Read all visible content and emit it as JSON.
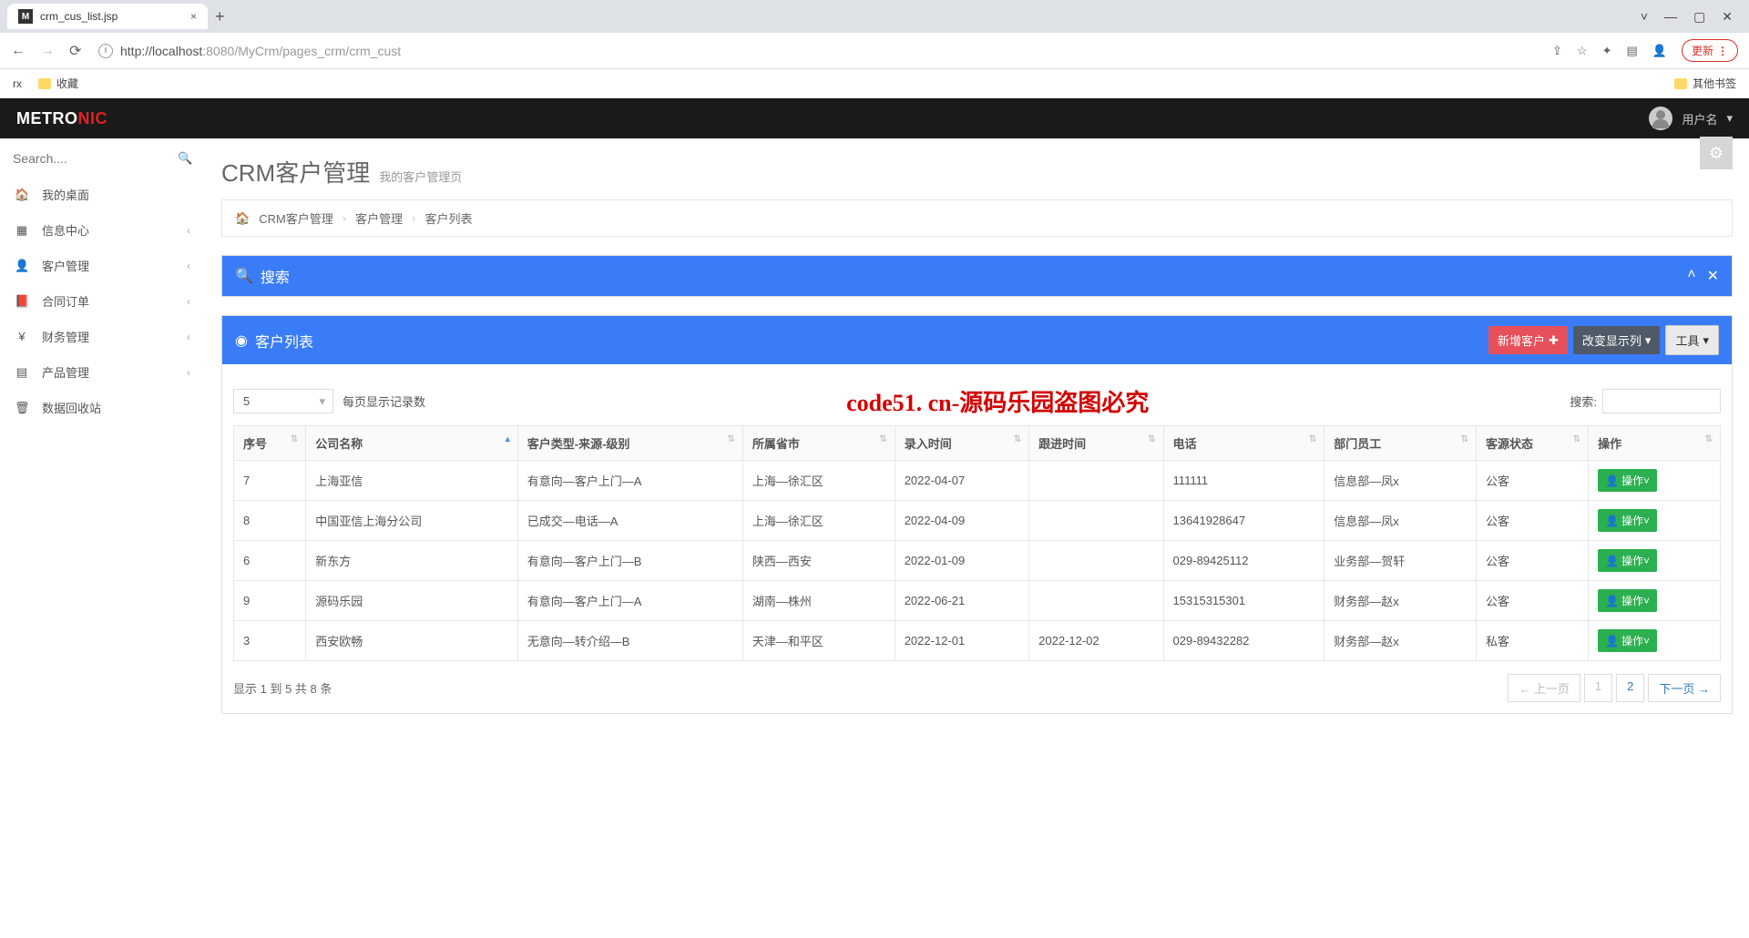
{
  "browser": {
    "tab_title": "crm_cus_list.jsp",
    "url_host": "http://localhost",
    "url_port": ":8080",
    "url_path": "/MyCrm/pages_crm/crm_cust",
    "update_btn": "更新",
    "bookmarks": [
      "rx",
      "收藏"
    ],
    "other_bookmarks": "其他书签"
  },
  "header": {
    "logo_main": "METRO",
    "logo_accent": "NIC",
    "username": "用户名"
  },
  "sidebar": {
    "search_placeholder": "Search....",
    "items": [
      {
        "label": "我的桌面",
        "expandable": false
      },
      {
        "label": "信息中心",
        "expandable": true
      },
      {
        "label": "客户管理",
        "expandable": true
      },
      {
        "label": "合同订单",
        "expandable": true
      },
      {
        "label": "财务管理",
        "expandable": true
      },
      {
        "label": "产品管理",
        "expandable": true
      },
      {
        "label": "数据回收站",
        "expandable": false
      }
    ]
  },
  "page": {
    "title": "CRM客户管理",
    "subtitle": "我的客户管理页",
    "breadcrumb": [
      "CRM客户管理",
      "客户管理",
      "客户列表"
    ]
  },
  "panels": {
    "search_title": "搜索",
    "list_title": "客户列表",
    "btn_add": "新增客户",
    "btn_cols": "改变显示列",
    "btn_tools": "工具"
  },
  "datatable": {
    "page_size": "5",
    "page_size_label": "每页显示记录数",
    "watermark": "code51. cn-源码乐园盗图必究",
    "search_label": "搜索:",
    "columns": [
      "序号",
      "公司名称",
      "客户类型-来源-级别",
      "所属省市",
      "录入时间",
      "跟进时间",
      "电话",
      "部门员工",
      "客源状态",
      "操作"
    ],
    "rows": [
      {
        "seq": "7",
        "company": "上海亚信",
        "type": "有意向—客户上门—A",
        "region": "上海—徐汇区",
        "in_time": "2022-04-07",
        "follow": "",
        "phone": "111111",
        "staff": "信息部—凤x",
        "status": "公客"
      },
      {
        "seq": "8",
        "company": "中国亚信上海分公司",
        "type": "已成交—电话—A",
        "region": "上海—徐汇区",
        "in_time": "2022-04-09",
        "follow": "",
        "phone": "13641928647",
        "staff": "信息部—凤x",
        "status": "公客"
      },
      {
        "seq": "6",
        "company": "新东方",
        "type": "有意向—客户上门—B",
        "region": "陕西—西安",
        "in_time": "2022-01-09",
        "follow": "",
        "phone": "029-89425112",
        "staff": "业务部—贺轩",
        "status": "公客"
      },
      {
        "seq": "9",
        "company": "源码乐园",
        "type": "有意向—客户上门—A",
        "region": "湖南—株州",
        "in_time": "2022-06-21",
        "follow": "",
        "phone": "15315315301",
        "staff": "财务部—赵x",
        "status": "公客"
      },
      {
        "seq": "3",
        "company": "西安欧畅",
        "type": "无意向—转介绍—B",
        "region": "天津—和平区",
        "in_time": "2022-12-01",
        "follow": "2022-12-02",
        "phone": "029-89432282",
        "staff": "财务部—赵x",
        "status": "私客"
      }
    ],
    "op_label": "操作",
    "info": "显示 1 到 5 共 8 条",
    "pager_prev": "← 上一页",
    "pager_next": "下一页 →",
    "pages": [
      "1",
      "2"
    ]
  }
}
